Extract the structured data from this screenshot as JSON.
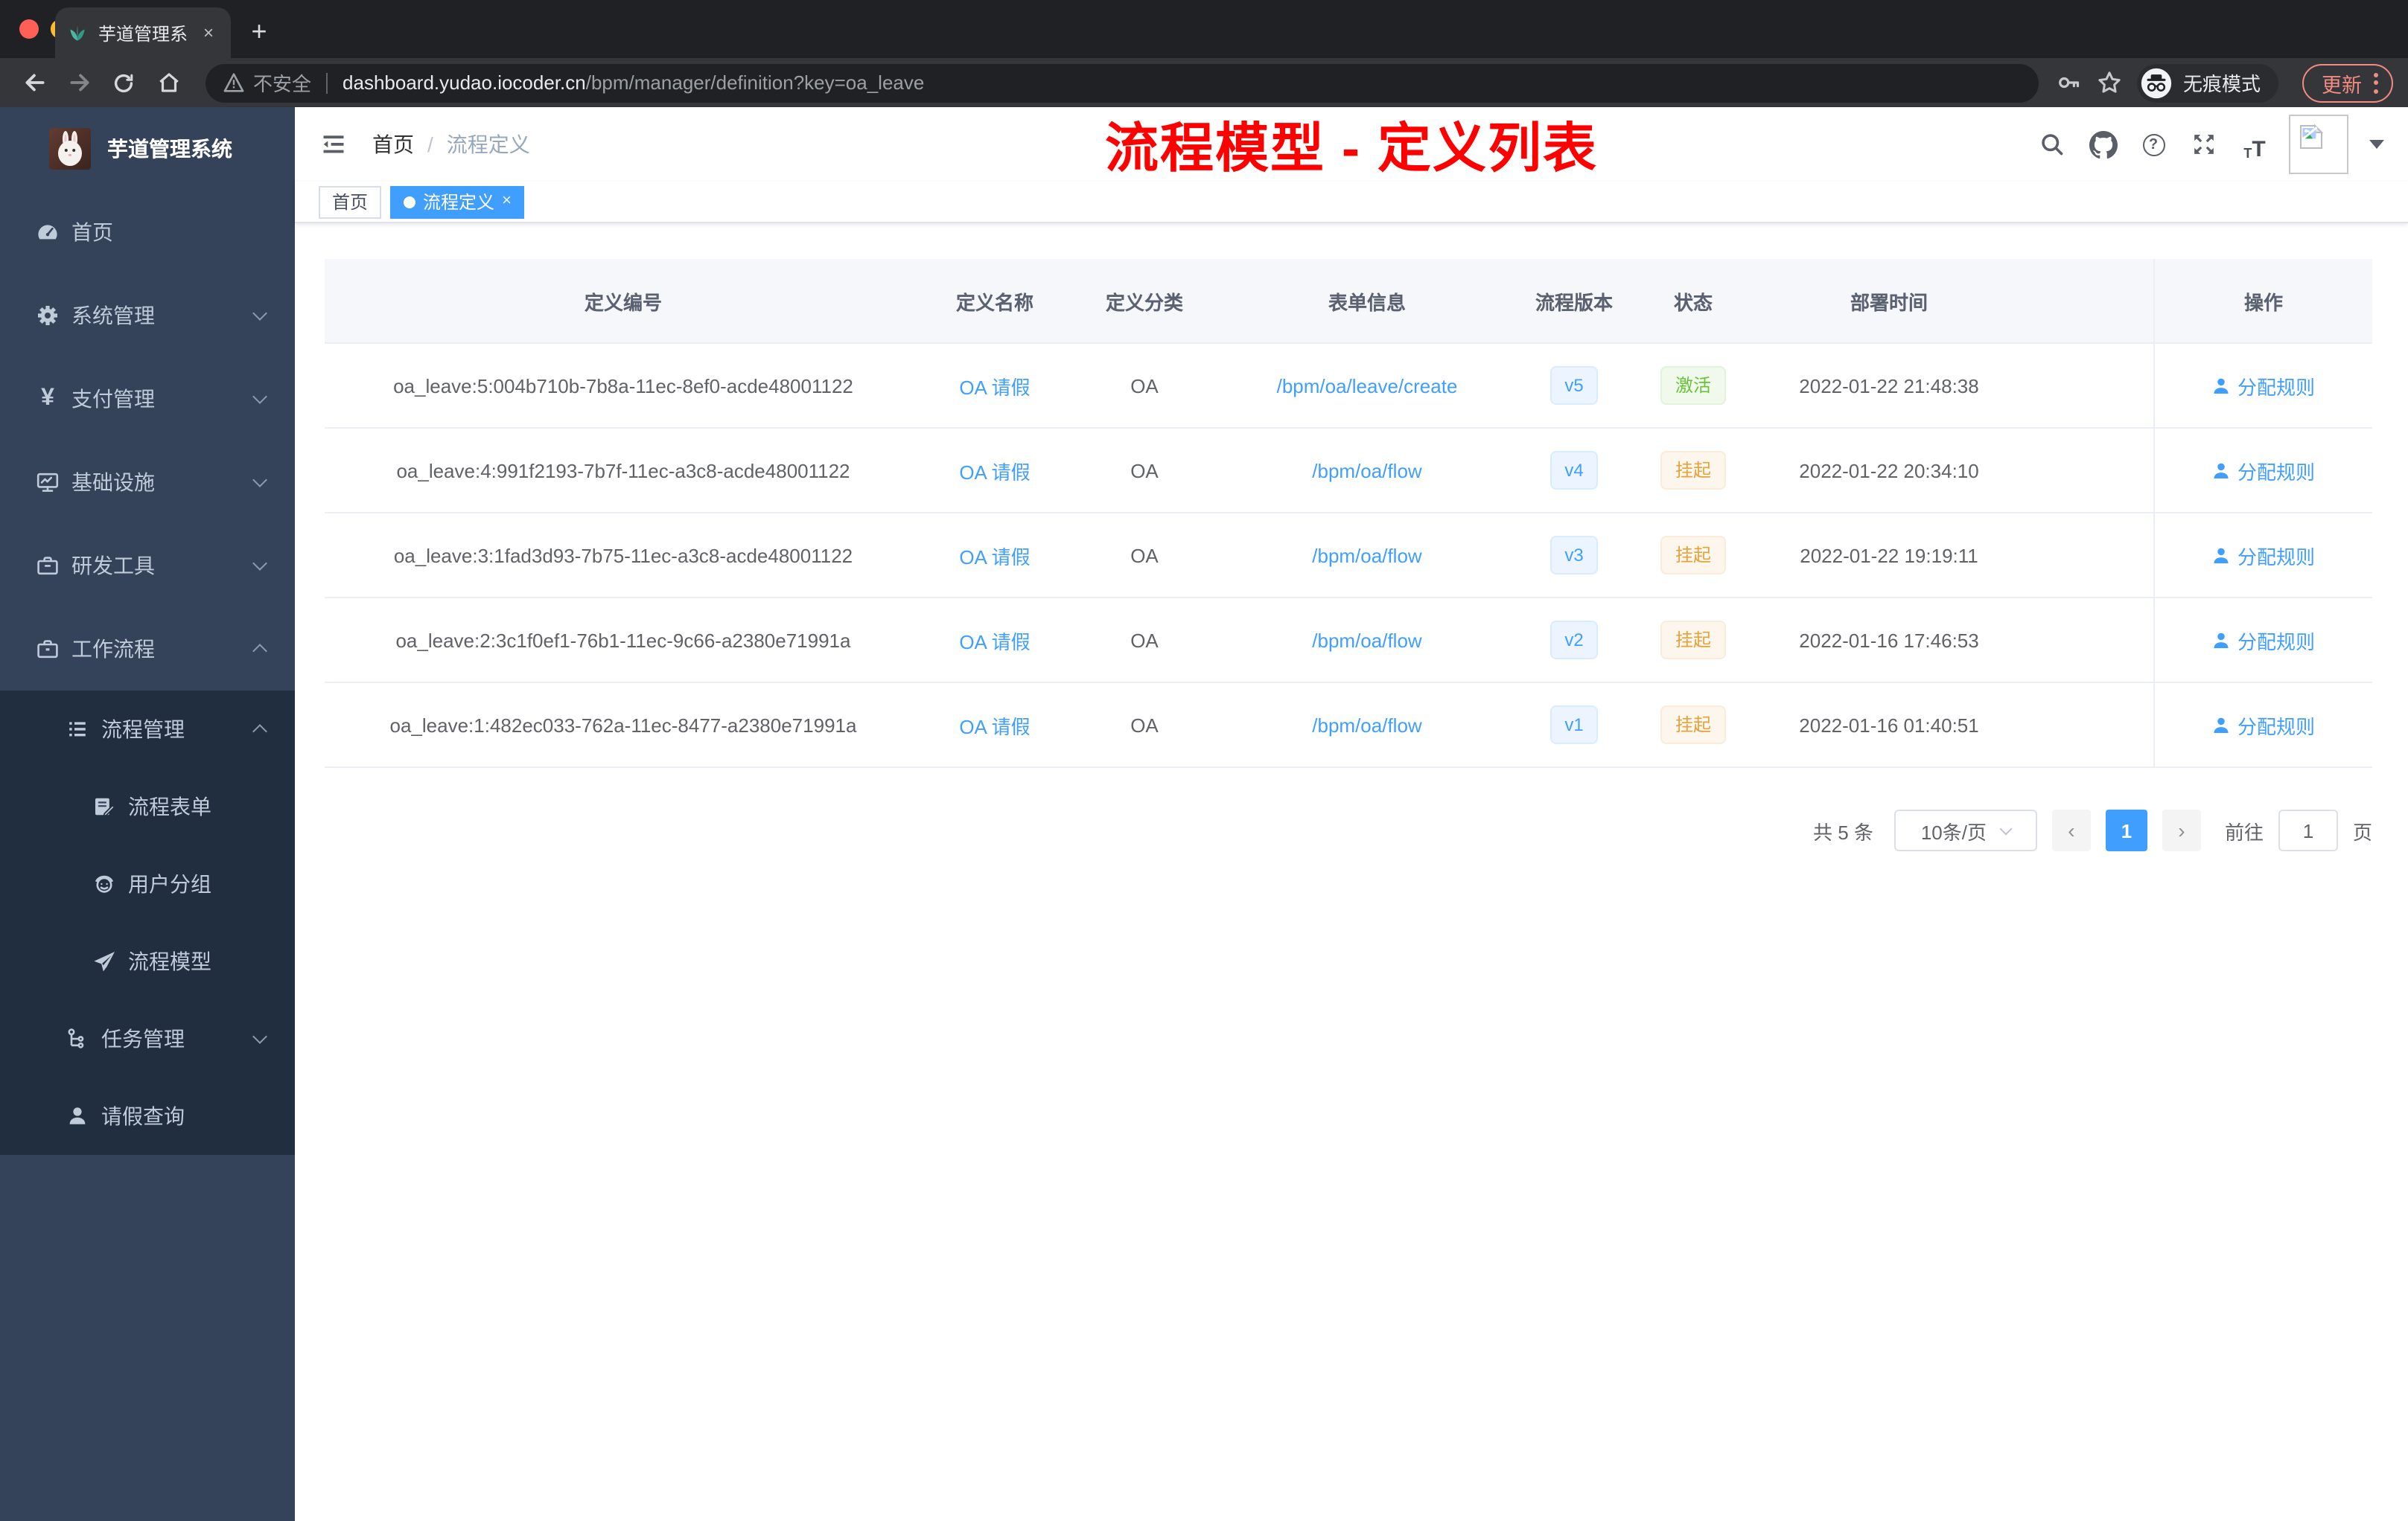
{
  "browser": {
    "tab": {
      "title": "芋道管理系统",
      "close_glyph": "×",
      "new_tab_glyph": "+"
    },
    "toolbar": {
      "security_label": "不安全",
      "url_domain": "dashboard.yudao.iocoder.cn",
      "url_path": "/bpm/manager/definition?key=oa_leave",
      "incognito_label": "无痕模式",
      "update_label": "更新"
    }
  },
  "sidebar": {
    "logo_title": "芋道管理系统",
    "items": [
      {
        "label": "首页"
      },
      {
        "label": "系统管理"
      },
      {
        "label": "支付管理"
      },
      {
        "label": "基础设施"
      },
      {
        "label": "研发工具"
      },
      {
        "label": "工作流程"
      }
    ],
    "submenu": {
      "items": [
        {
          "label": "流程管理"
        },
        {
          "label": "流程表单"
        },
        {
          "label": "用户分组"
        },
        {
          "label": "流程模型"
        },
        {
          "label": "任务管理"
        },
        {
          "label": "请假查询"
        }
      ]
    },
    "yen_glyph": "¥"
  },
  "header": {
    "breadcrumb": {
      "home": "首页",
      "separator": "/",
      "current": "流程定义"
    },
    "annotation": "流程模型 - 定义列表",
    "fontsize_small": "T",
    "fontsize_big": "T"
  },
  "tags": {
    "items": [
      {
        "label": "首页",
        "active": false
      },
      {
        "label": "流程定义",
        "active": true
      }
    ],
    "close_glyph": "×"
  },
  "table": {
    "columns": [
      "定义编号",
      "定义名称",
      "定义分类",
      "表单信息",
      "流程版本",
      "状态",
      "部署时间",
      "操作"
    ],
    "rows": [
      {
        "id": "oa_leave:5:004b710b-7b8a-11ec-8ef0-acde48001122",
        "name": "OA 请假",
        "category": "OA",
        "form": "/bpm/oa/leave/create",
        "version": "v5",
        "status": "激活",
        "deployed": "2022-01-22 21:48:38",
        "action": "分配规则"
      },
      {
        "id": "oa_leave:4:991f2193-7b7f-11ec-a3c8-acde48001122",
        "name": "OA 请假",
        "category": "OA",
        "form": "/bpm/oa/flow",
        "version": "v4",
        "status": "挂起",
        "deployed": "2022-01-22 20:34:10",
        "action": "分配规则"
      },
      {
        "id": "oa_leave:3:1fad3d93-7b75-11ec-a3c8-acde48001122",
        "name": "OA 请假",
        "category": "OA",
        "form": "/bpm/oa/flow",
        "version": "v3",
        "status": "挂起",
        "deployed": "2022-01-22 19:19:11",
        "action": "分配规则"
      },
      {
        "id": "oa_leave:2:3c1f0ef1-76b1-11ec-9c66-a2380e71991a",
        "name": "OA 请假",
        "category": "OA",
        "form": "/bpm/oa/flow",
        "version": "v2",
        "status": "挂起",
        "deployed": "2022-01-16 17:46:53",
        "action": "分配规则"
      },
      {
        "id": "oa_leave:1:482ec033-762a-11ec-8477-a2380e71991a",
        "name": "OA 请假",
        "category": "OA",
        "form": "/bpm/oa/flow",
        "version": "v1",
        "status": "挂起",
        "deployed": "2022-01-16 01:40:51",
        "action": "分配规则"
      }
    ]
  },
  "pagination": {
    "total": "共 5 条",
    "page_size": "10条/页",
    "prev_glyph": "‹",
    "current_page": "1",
    "next_glyph": "›",
    "goto_label": "前往",
    "goto_value": "1",
    "goto_suffix": "页"
  },
  "colors": {
    "accent": "#409eff",
    "status_active_green": "#67c23a",
    "status_suspended_orange": "#e6a23c",
    "annotation_red": "#fe0000",
    "sidebar_bg": "#34435a",
    "submenu_bg": "#202e40"
  }
}
